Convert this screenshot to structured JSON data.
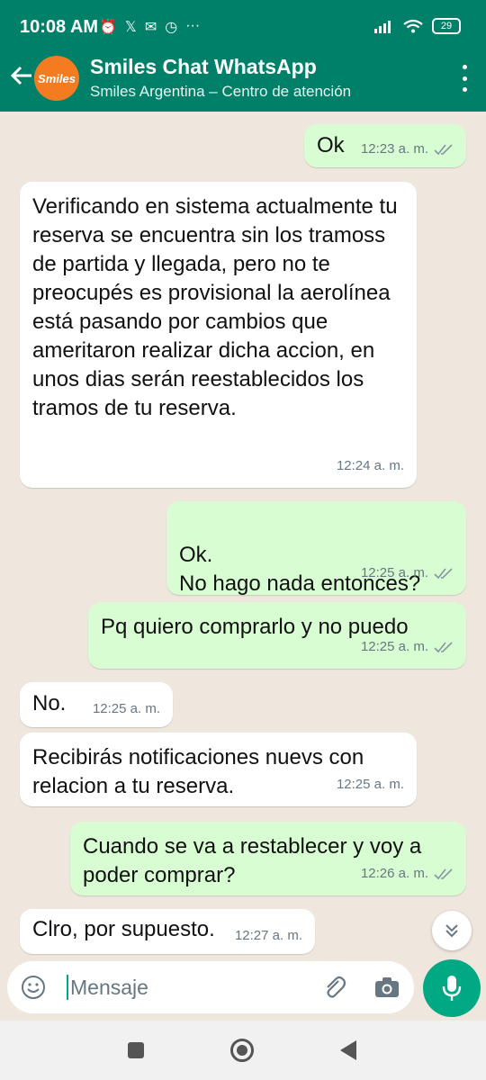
{
  "status_bar": {
    "time": "10:08 AM",
    "battery": "29"
  },
  "header": {
    "title": "Smiles Chat WhatsApp",
    "subtitle": "Smiles Argentina – Centro de atención",
    "avatar_text": "Smiles"
  },
  "messages": [
    {
      "direction": "out",
      "text": "Ok",
      "time": "12:23 a. m."
    },
    {
      "direction": "in",
      "text": "Verificando en sistema actualmente tu reserva se encuentra sin los tramoss de partida y llegada, pero no te preocupés es provisional la aerolínea está pasando por cambios que ameritaron realizar dicha accion, en unos dias serán reestablecidos los tramos de tu reserva.",
      "time": "12:24 a. m."
    },
    {
      "direction": "out",
      "text": "Ok.\nNo hago nada entonces?",
      "time": "12:25 a. m."
    },
    {
      "direction": "out",
      "text": "Pq quiero comprarlo y no puedo",
      "time": "12:25 a. m."
    },
    {
      "direction": "in",
      "text": "No.",
      "time": "12:25 a. m."
    },
    {
      "direction": "in",
      "text": "Recibirás notificaciones nuevs con relacion a tu reserva.",
      "time": "12:25 a. m."
    },
    {
      "direction": "out",
      "text": "Cuando se va a restablecer y voy a poder comprar?",
      "time": "12:26 a. m."
    },
    {
      "direction": "in",
      "text": "Clro, por supuesto.",
      "time": "12:27 a. m."
    }
  ],
  "composer": {
    "placeholder": "Mensaje"
  },
  "colors": {
    "header": "#008069",
    "outgoing_bubble": "#d9fdd3",
    "incoming_bubble": "#ffffff",
    "accent": "#00a884",
    "chat_background": "#efe7de",
    "ticks": "#8696a0"
  }
}
